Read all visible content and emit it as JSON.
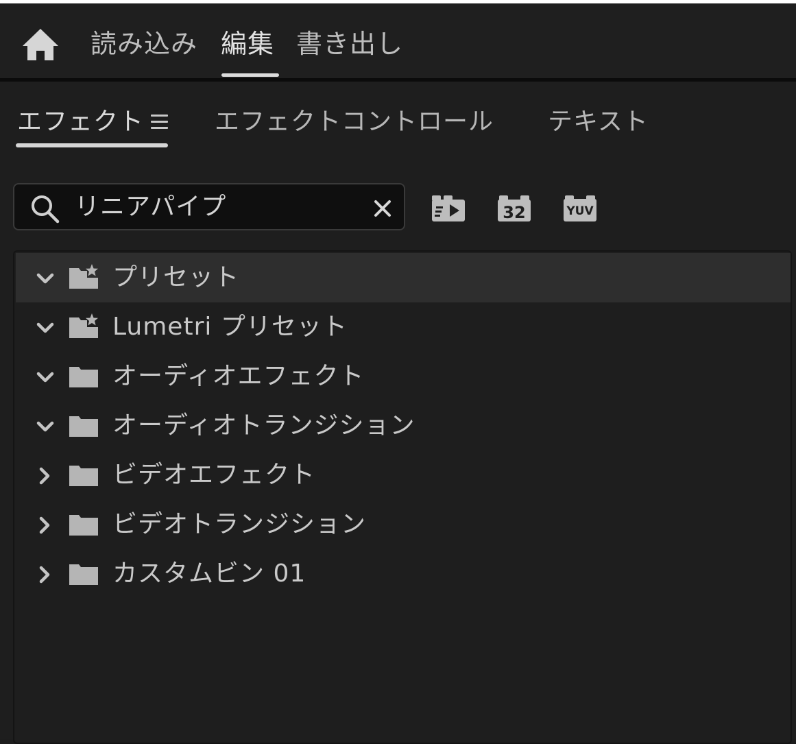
{
  "nav": {
    "tabs": [
      {
        "label": "読み込み"
      },
      {
        "label": "編集"
      },
      {
        "label": "書き出し"
      }
    ],
    "active_tab": "編集"
  },
  "panel": {
    "tabs": [
      {
        "label": "エフェクト"
      },
      {
        "label": "エフェクトコントロール"
      },
      {
        "label": "テキスト"
      }
    ],
    "active_tab": "エフェクト"
  },
  "search": {
    "value": "リニアパイプ",
    "placeholder": ""
  },
  "toolbar": {
    "icons": [
      "accelerated-effects-icon",
      "32-bit-effects-icon",
      "yuv-effects-icon"
    ],
    "bit_label": "32",
    "yuv_label": "YUV"
  },
  "tree": {
    "items": [
      {
        "label": "プリセット",
        "expanded": true,
        "icon": "preset-folder-icon",
        "selected": true
      },
      {
        "label": "Lumetri プリセット",
        "expanded": true,
        "icon": "preset-folder-icon"
      },
      {
        "label": "オーディオエフェクト",
        "expanded": true,
        "icon": "folder-icon"
      },
      {
        "label": "オーディオトランジション",
        "expanded": true,
        "icon": "folder-icon"
      },
      {
        "label": "ビデオエフェクト",
        "expanded": false,
        "icon": "folder-icon"
      },
      {
        "label": "ビデオトランジション",
        "expanded": false,
        "icon": "folder-icon"
      },
      {
        "label": "カスタムビン 01",
        "expanded": false,
        "icon": "folder-icon"
      }
    ]
  },
  "colors": {
    "background": "#1e1e1e",
    "selected_row": "#2e2e2e",
    "text": "#c9c9c9",
    "icon": "#b5b5b5",
    "underline": "#d6d6d6"
  }
}
